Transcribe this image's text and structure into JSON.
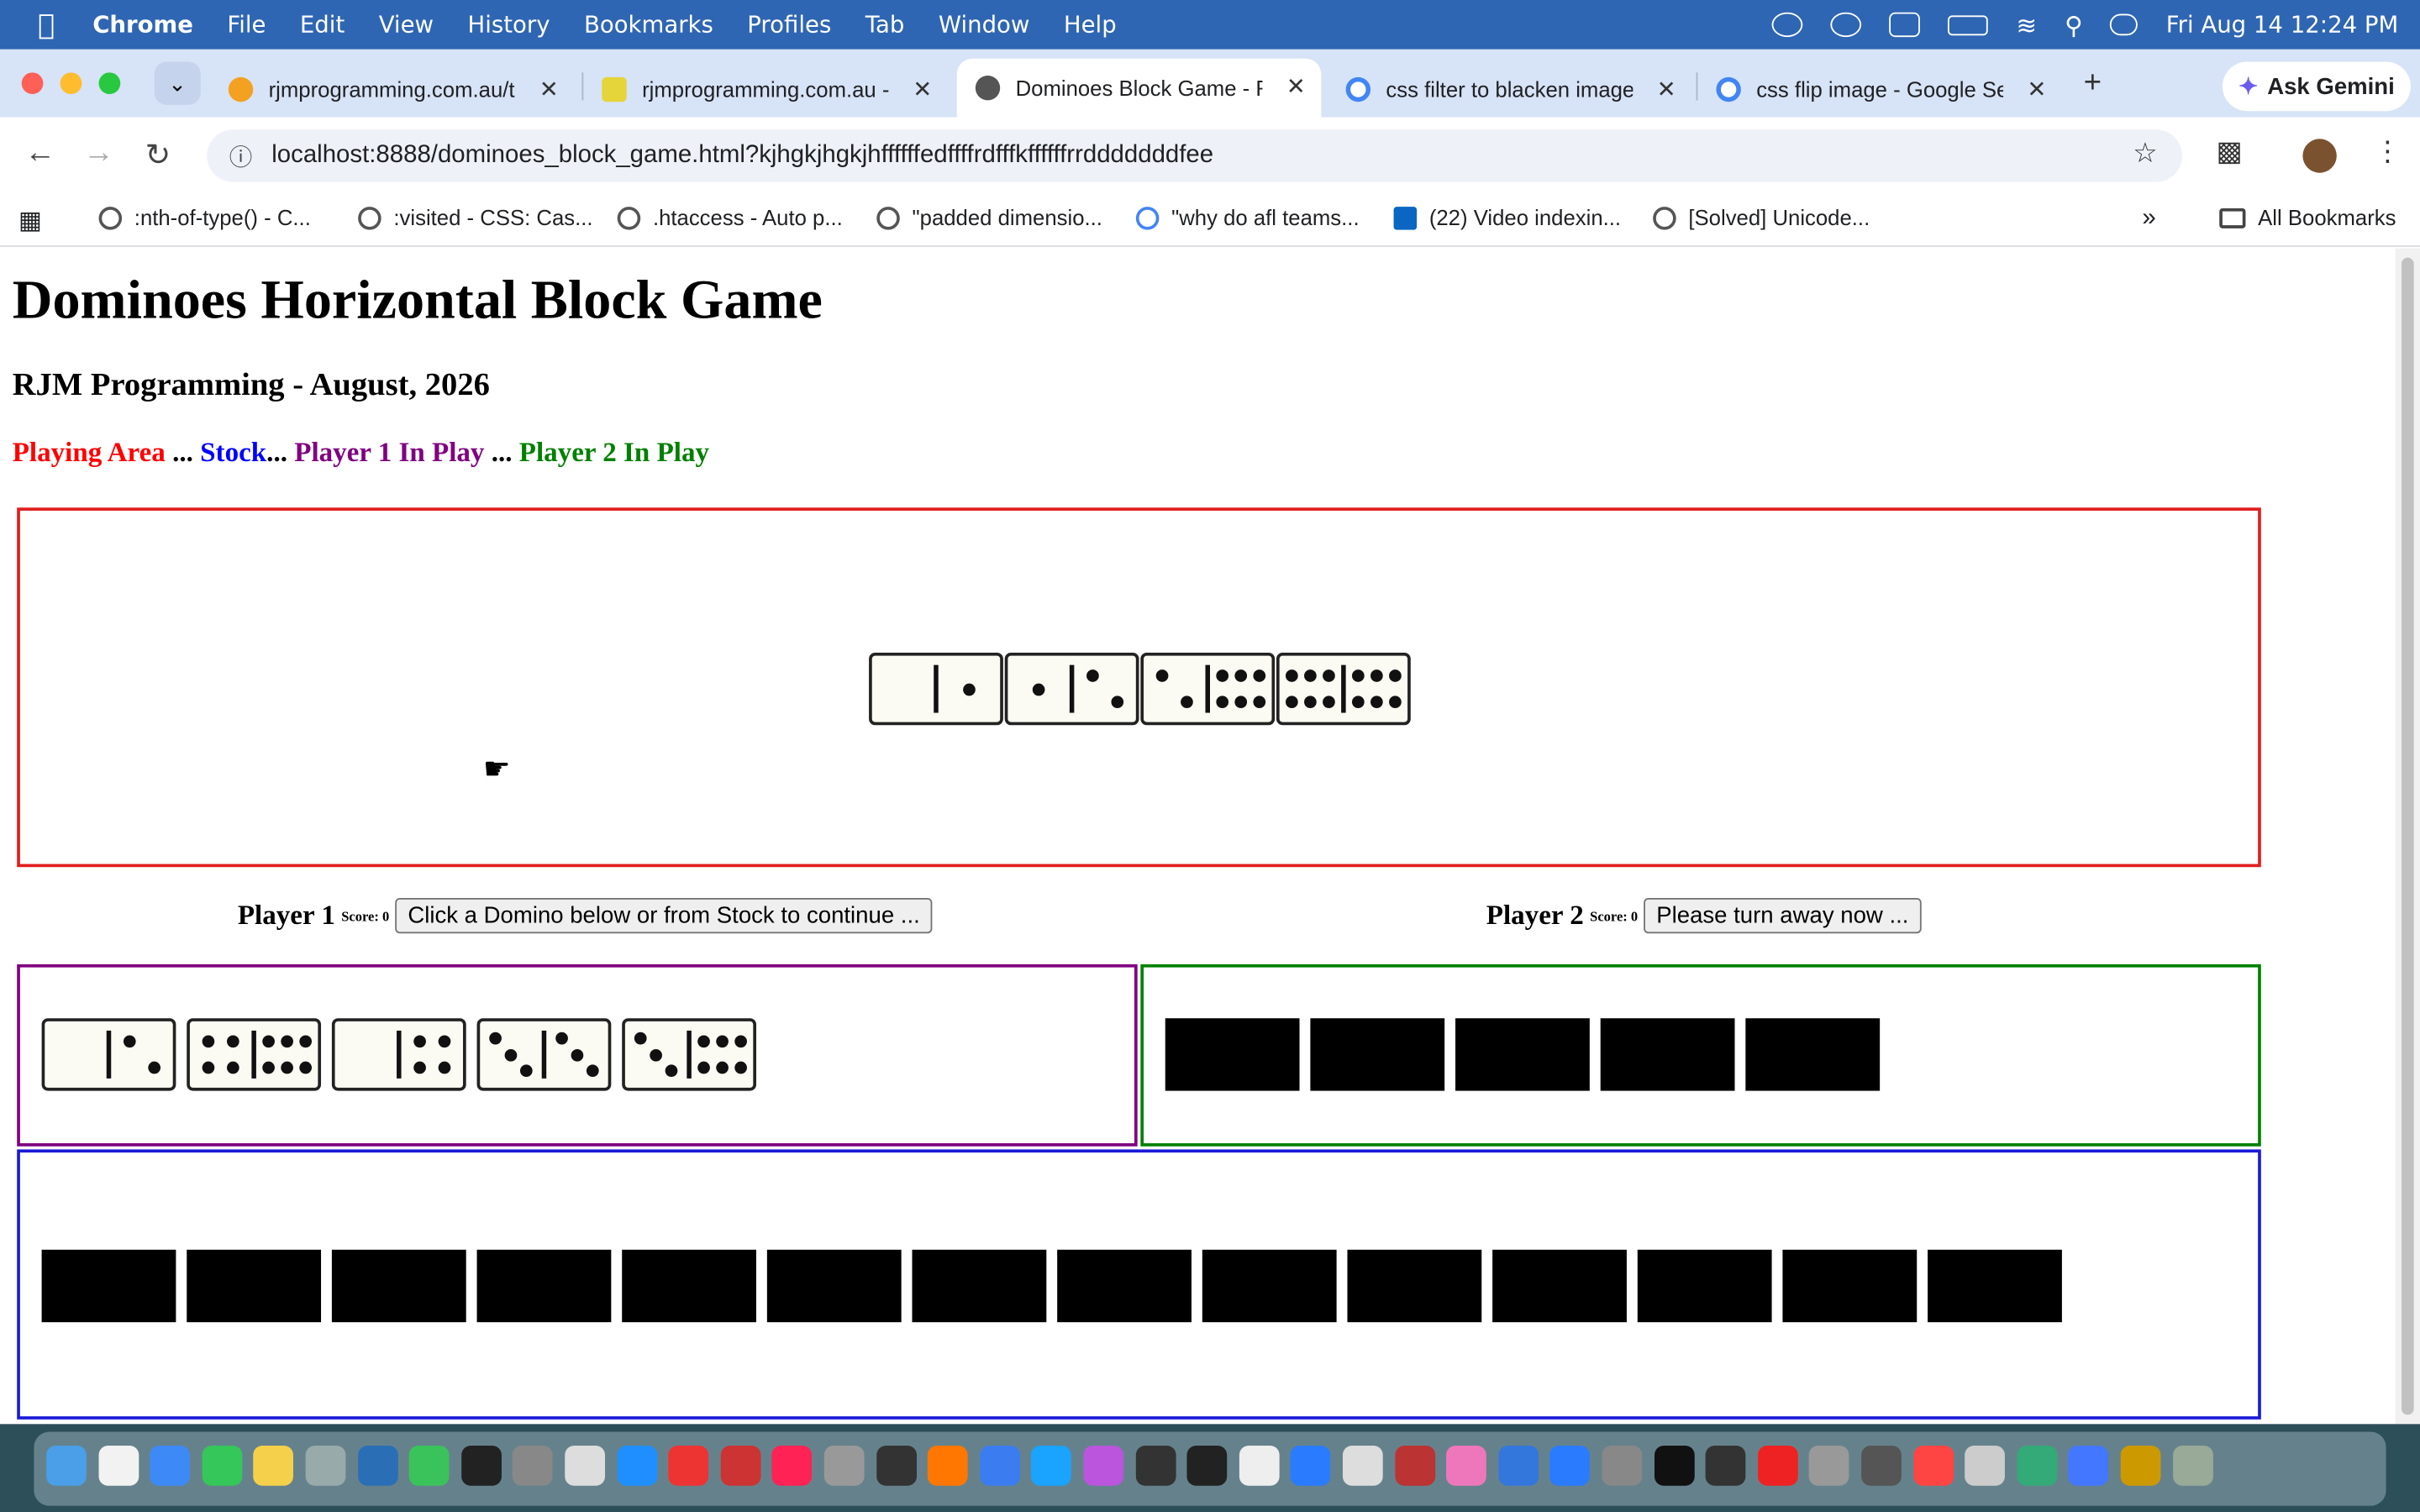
{
  "menubar": {
    "app": "Chrome",
    "items": [
      "File",
      "Edit",
      "View",
      "History",
      "Bookmarks",
      "Profiles",
      "Tab",
      "Window",
      "Help"
    ],
    "datetime": "Fri Aug 14  12:24 PM"
  },
  "tabs": [
    {
      "title": "rjmprogramming.com.au/tc",
      "color": "#f4a020"
    },
    {
      "title": "rjmprogramming.com.au -",
      "color": "#e5d43a"
    },
    {
      "title": "Dominoes Block Game - R",
      "color": "#555555",
      "active": true
    },
    {
      "title": "css filter to blacken image",
      "color": "#4285f4"
    },
    {
      "title": "css flip image - Google Se",
      "color": "#4285f4"
    }
  ],
  "ask_gemini": "Ask Gemini",
  "url": "localhost:8888/dominoes_block_game.html?kjhgkjhgkjhffffffedffffrdfffkffffffrrdddddddfee",
  "bookmarks": [
    ":nth-of-type() - C...",
    ":visited - CSS: Cas...",
    ".htaccess - Auto p...",
    "\"padded dimensio...",
    "\"why do afl teams...",
    "(22) Video indexin...",
    "[Solved] Unicode..."
  ],
  "all_bookmarks": "All Bookmarks",
  "page": {
    "title": "Dominoes Horizontal Block Game",
    "subtitle": "RJM Programming - August, 2026",
    "legend": {
      "playing_area": "Playing Area",
      "sep1": " ... ",
      "stock": "Stock",
      "sep2": "... ",
      "player1": "Player 1 In Play",
      "sep3": " ... ",
      "player2": "Player 2 In Play"
    },
    "player1": {
      "name": "Player 1",
      "score_label": "Score: 0",
      "button": "Click a Domino below or from Stock to continue ..."
    },
    "player2": {
      "name": "Player 2",
      "score_label": "Score: 0",
      "button": "Please turn away now ..."
    },
    "play_area_dominoes": [
      [
        0,
        1
      ],
      [
        1,
        2
      ],
      [
        2,
        6
      ],
      [
        6,
        6
      ]
    ],
    "player1_dominoes": [
      [
        0,
        2
      ],
      [
        4,
        6
      ],
      [
        0,
        4
      ],
      [
        3,
        3
      ],
      [
        3,
        6
      ]
    ],
    "player2_hidden_count": 5,
    "stock_hidden_count": 14
  },
  "colors": {
    "playing_area": "#ff0000",
    "stock": "#0000ff",
    "player1": "#800080",
    "player2": "#008000",
    "menubar": "#2f66b3"
  }
}
